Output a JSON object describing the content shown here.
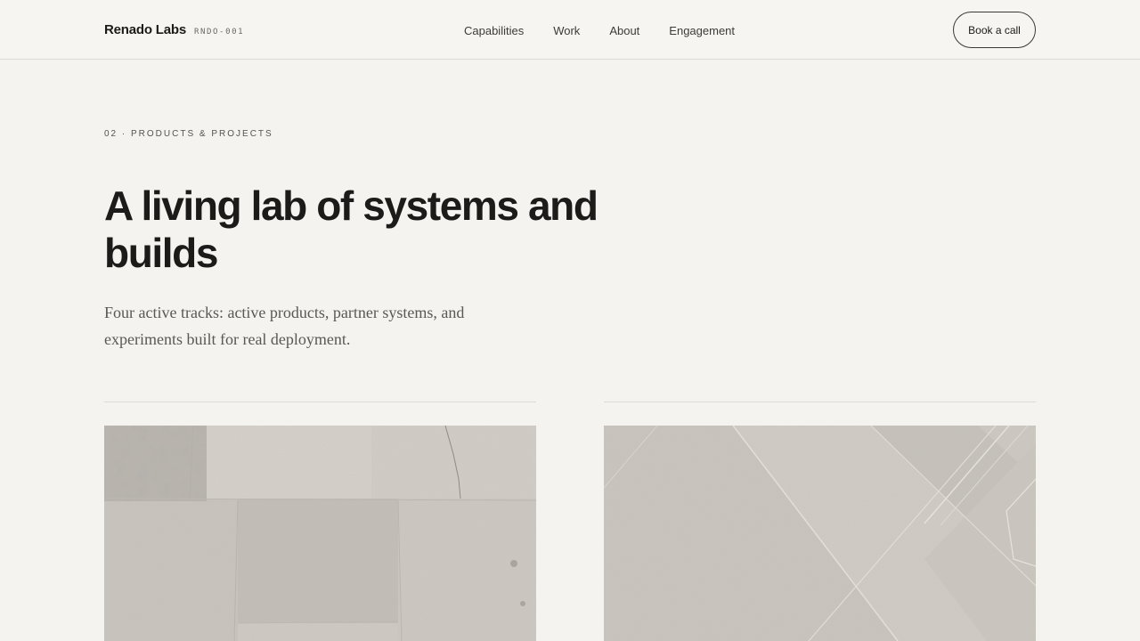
{
  "header": {
    "brand_name": "Renado Labs",
    "brand_code": "RNDO-001",
    "nav": [
      {
        "label": "Capabilities"
      },
      {
        "label": "Work"
      },
      {
        "label": "About"
      },
      {
        "label": "Engagement"
      }
    ],
    "cta_label": "Book a call"
  },
  "section": {
    "eyebrow": "02 · PRODUCTS & PROJECTS",
    "title": "A living lab of systems and builds",
    "lede": "Four active tracks: active products, partner systems, and experiments built for real deployment."
  },
  "cards": [
    {
      "image": "concrete-slab-texture"
    },
    {
      "image": "concrete-diagonal-texture"
    }
  ],
  "colors": {
    "background": "#f4f3ef",
    "text": "#1c1b19",
    "muted": "#5a5852",
    "rule": "#dcdad4"
  }
}
